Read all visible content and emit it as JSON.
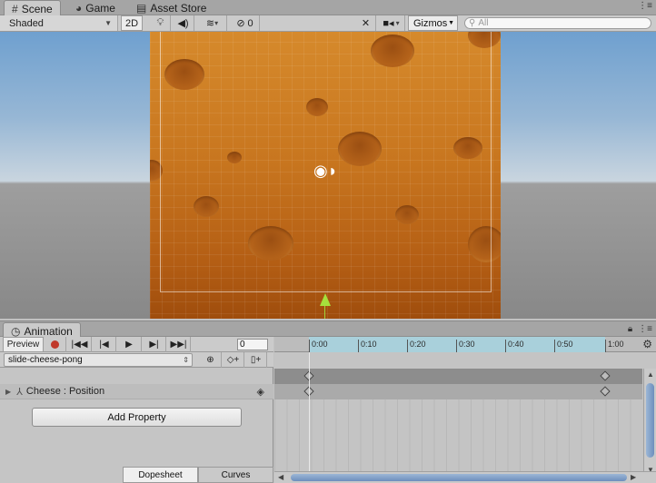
{
  "scene_tabs": [
    {
      "label": "Scene",
      "icon": "scene-hash-icon"
    },
    {
      "label": "Game",
      "icon": "pacman-icon"
    },
    {
      "label": "Asset Store",
      "icon": "store-bag-icon"
    }
  ],
  "scene_toolbar": {
    "shading_mode": "Shaded",
    "mode_2d": "2D",
    "hidden_count": "0",
    "gizmos_label": "Gizmos",
    "search_placeholder": "All"
  },
  "animation": {
    "tab_label": "Animation",
    "preview_label": "Preview",
    "current_frame": "0",
    "clip_name": "slide-cheese-pong",
    "property_object": "Cheese",
    "property_name": "Position",
    "property_label": "Cheese : Position",
    "add_property_label": "Add Property",
    "modes": [
      "Dopesheet",
      "Curves"
    ],
    "active_mode": "Dopesheet",
    "timeline_ticks": [
      "0:00",
      "0:10",
      "0:20",
      "0:30",
      "0:40",
      "0:50",
      "1:00"
    ],
    "keyframes": [
      "0:00",
      "1:00"
    ]
  },
  "colors": {
    "record": "#c0392b",
    "ruler_range": "#a9d0db",
    "pivot_arrow": "#a6e03c",
    "cheese": "#c8761f"
  }
}
